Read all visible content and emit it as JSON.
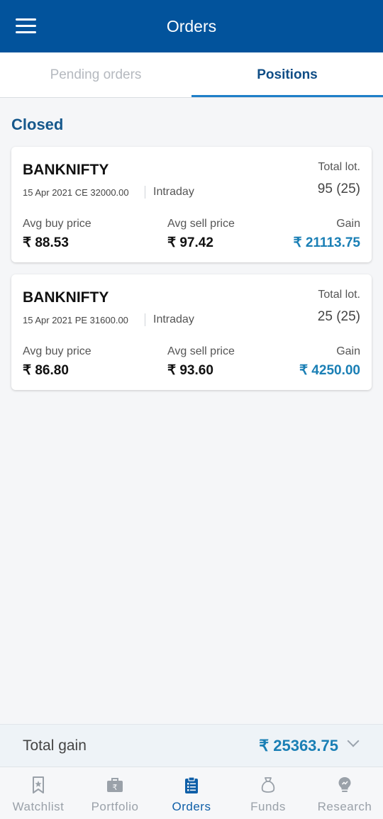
{
  "header": {
    "title": "Orders",
    "menu_icon": "hamburger-menu-icon"
  },
  "tabs": [
    {
      "label": "Pending orders",
      "active": false
    },
    {
      "label": "Positions",
      "active": true
    }
  ],
  "section": {
    "title": "Closed"
  },
  "positions": [
    {
      "symbol": "BANKNIFTY",
      "contract": "15 Apr 2021 CE 32000.00",
      "product": "Intraday",
      "total_lot_label": "Total lot.",
      "total_lot_value": "95 (25)",
      "avg_buy_label": "Avg buy price",
      "avg_buy_value": "₹ 88.53",
      "avg_sell_label": "Avg sell price",
      "avg_sell_value": "₹ 97.42",
      "gain_label": "Gain",
      "gain_value": "₹ 21113.75"
    },
    {
      "symbol": "BANKNIFTY",
      "contract": "15 Apr 2021 PE 31600.00",
      "product": "Intraday",
      "total_lot_label": "Total lot.",
      "total_lot_value": "25 (25)",
      "avg_buy_label": "Avg buy price",
      "avg_buy_value": "₹ 86.80",
      "avg_sell_label": "Avg sell price",
      "avg_sell_value": "₹ 93.60",
      "gain_label": "Gain",
      "gain_value": "₹ 4250.00"
    }
  ],
  "summary": {
    "label": "Total gain",
    "value": "₹ 25363.75"
  },
  "nav": [
    {
      "label": "Watchlist",
      "icon": "bookmark-star-icon",
      "active": false
    },
    {
      "label": "Portfolio",
      "icon": "briefcase-rupee-icon",
      "active": false
    },
    {
      "label": "Orders",
      "icon": "clipboard-list-icon",
      "active": true
    },
    {
      "label": "Funds",
      "icon": "money-bag-icon",
      "active": false
    },
    {
      "label": "Research",
      "icon": "lightbulb-icon",
      "active": false
    }
  ],
  "colors": {
    "header_bg": "#02539c",
    "accent": "#1a7fb5",
    "tab_active": "#0f4d86",
    "nav_active": "#0f5fa8",
    "nav_inactive": "#9aa1a9"
  }
}
